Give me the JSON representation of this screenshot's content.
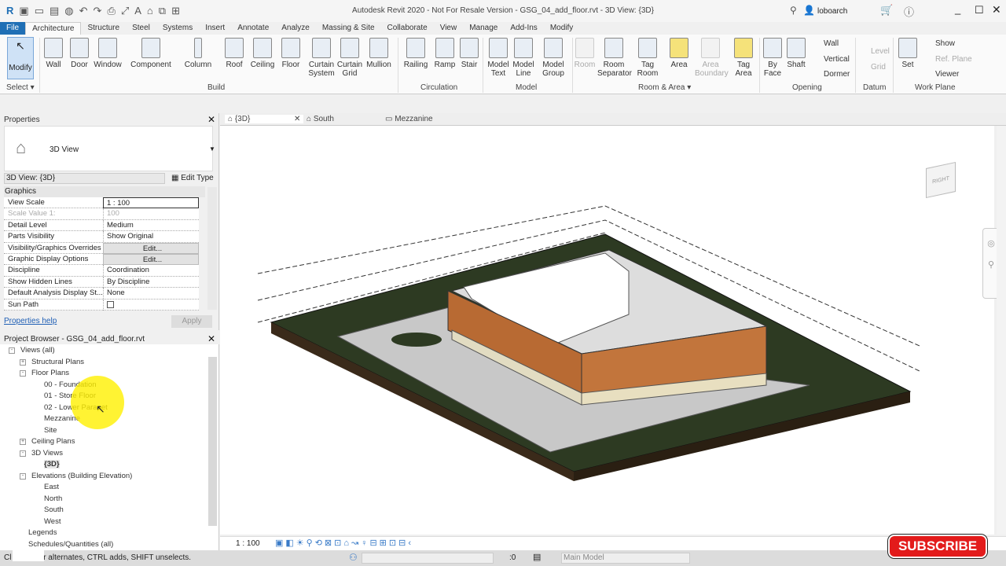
{
  "app": {
    "title": "Autodesk Revit 2020 - Not For Resale Version - GSG_04_add_floor.rvt - 3D View: {3D}",
    "user": "loboarch"
  },
  "tabs": [
    "File",
    "Architecture",
    "Structure",
    "Steel",
    "Systems",
    "Insert",
    "Annotate",
    "Analyze",
    "Massing & Site",
    "Collaborate",
    "View",
    "Manage",
    "Add-Ins",
    "Modify"
  ],
  "ribbon": {
    "select": {
      "modify": "Modify",
      "label": "Select ▾"
    },
    "build": {
      "label": "Build",
      "items": [
        "Wall",
        "Door",
        "Window",
        "Component",
        "Column",
        "Roof",
        "Ceiling",
        "Floor",
        "Curtain System",
        "Curtain Grid",
        "Mullion"
      ]
    },
    "circulation": {
      "label": "Circulation",
      "items": [
        "Railing",
        "Ramp",
        "Stair"
      ]
    },
    "model": {
      "label": "Model",
      "items": [
        "Model Text",
        "Model Line",
        "Model Group"
      ]
    },
    "room": {
      "label": "Room & Area ▾",
      "items": [
        "Room",
        "Room Separator",
        "Tag Room",
        "Area",
        "Area Boundary",
        "Tag Area"
      ]
    },
    "opening": {
      "label": "Opening",
      "items": [
        "By Face",
        "Shaft"
      ],
      "small": [
        "Wall",
        "Vertical",
        "Dormer"
      ]
    },
    "datum": {
      "label": "Datum",
      "small": [
        "Level",
        "Grid"
      ]
    },
    "workplane": {
      "label": "Work Plane",
      "set": "Set",
      "small": [
        "Show",
        "Ref. Plane",
        "Viewer"
      ]
    }
  },
  "properties": {
    "title": "Properties",
    "type": "3D View",
    "instance": "3D View: {3D}",
    "edit_type": "Edit Type",
    "group": "Graphics",
    "rows": [
      {
        "k": "View Scale",
        "v": "1 : 100"
      },
      {
        "k": "Scale Value    1:",
        "v": "100"
      },
      {
        "k": "Detail Level",
        "v": "Medium"
      },
      {
        "k": "Parts Visibility",
        "v": "Show Original"
      },
      {
        "k": "Visibility/Graphics Overrides",
        "v": "Edit..."
      },
      {
        "k": "Graphic Display Options",
        "v": "Edit..."
      },
      {
        "k": "Discipline",
        "v": "Coordination"
      },
      {
        "k": "Show Hidden Lines",
        "v": "By Discipline"
      },
      {
        "k": "Default Analysis Display St...",
        "v": "None"
      },
      {
        "k": "Sun Path",
        "v": ""
      }
    ],
    "help": "Properties help",
    "apply": "Apply"
  },
  "browser": {
    "title": "Project Browser - GSG_04_add_floor.rvt",
    "nodes": [
      "Views (all)",
      "Structural Plans",
      "Floor Plans",
      "00 - Foundation",
      "01 - Store Floor",
      "02 - Lower Parapet",
      "Mezzanine",
      "Site",
      "Ceiling Plans",
      "3D Views",
      "{3D}",
      "Elevations (Building Elevation)",
      "East",
      "North",
      "South",
      "West",
      "Legends",
      "Schedules/Quantities (all)"
    ]
  },
  "view_tabs": [
    "{3D}",
    "South",
    "Mezzanine"
  ],
  "view_cube": {
    "face": "RIGHT"
  },
  "view_bar": {
    "scale": "1 : 100"
  },
  "status": {
    "text": "Click to select, TAB for alternates, CTRL adds, SHIFT unselects.",
    "visible_text": "Cl    t, TAB for alternates, CTRL adds, SHIFT unselects.",
    "count": ":0",
    "model": "Main Model"
  },
  "overlay": {
    "subscribe": "SUBSCRIBE"
  },
  "colors": {
    "file_tab": "#1f6fb5",
    "ground": "#2d3a22",
    "brick": "#b86a33",
    "subscribe": "#e31b1b"
  }
}
